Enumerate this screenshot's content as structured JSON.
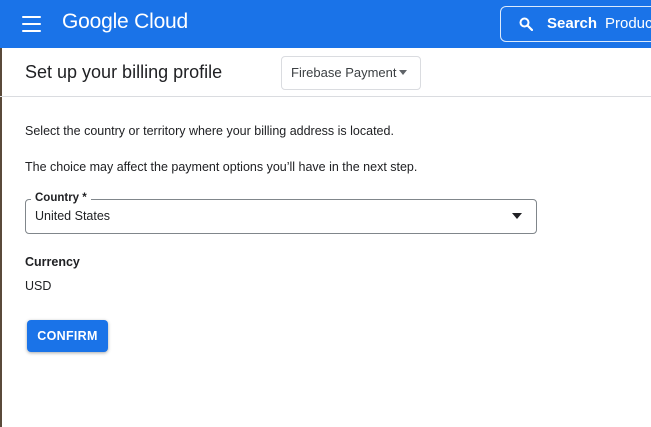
{
  "app_bar": {
    "menu_icon": "hamburger-menu-icon",
    "logo_text": "Google Cloud",
    "search": {
      "icon": "search-icon",
      "label": "Search",
      "placeholder": "Produc"
    },
    "background_color": "#1a73e8"
  },
  "header": {
    "title": "Set up your billing profile",
    "account_select": {
      "selected": "Firebase Payment",
      "caret_icon": "caret-down-icon"
    }
  },
  "form": {
    "intro_text": "Select the country or territory where your billing address is located.",
    "note_text": "The choice may affect the payment options you’ll have in the next step.",
    "country": {
      "label": "Country *",
      "value": "United States",
      "caret_icon": "dropdown-arrow-icon"
    },
    "currency": {
      "label": "Currency",
      "value": "USD"
    },
    "confirm_label": "CONFIRM",
    "accent_color": "#1a73e8"
  }
}
